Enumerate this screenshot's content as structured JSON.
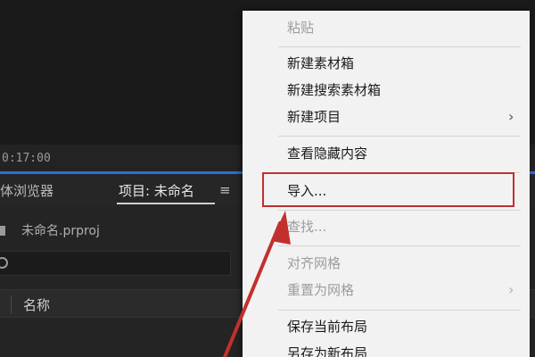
{
  "timeline": {
    "timecode": "0:17:00"
  },
  "project_panel": {
    "tab_media_browser": "体浏览器",
    "tab_project": "项目: 未命名",
    "project_file": "未命名.prproj",
    "search_placeholder": "",
    "column_name": "名称"
  },
  "context_menu": {
    "items": {
      "paste": "粘贴",
      "new_bin": "新建素材箱",
      "new_search_bin": "新建搜索素材箱",
      "new_item": "新建项目",
      "view_hidden": "查看隐藏内容",
      "import": "导入...",
      "find": "查找...",
      "align_to_grid": "对齐网格",
      "reset_to_grid": "重置为网格",
      "save_layout": "保存当前布局",
      "save_as_new_layout": "另存为新布局"
    },
    "submenu_arrow": "›"
  },
  "annotation": {
    "highlight_color": "#c2302e",
    "arrow_color": "#c2302e"
  },
  "colors": {
    "accent_blue": "#2a6fd4",
    "menu_background": "#f2f2f2",
    "panel_background": "#242424"
  }
}
